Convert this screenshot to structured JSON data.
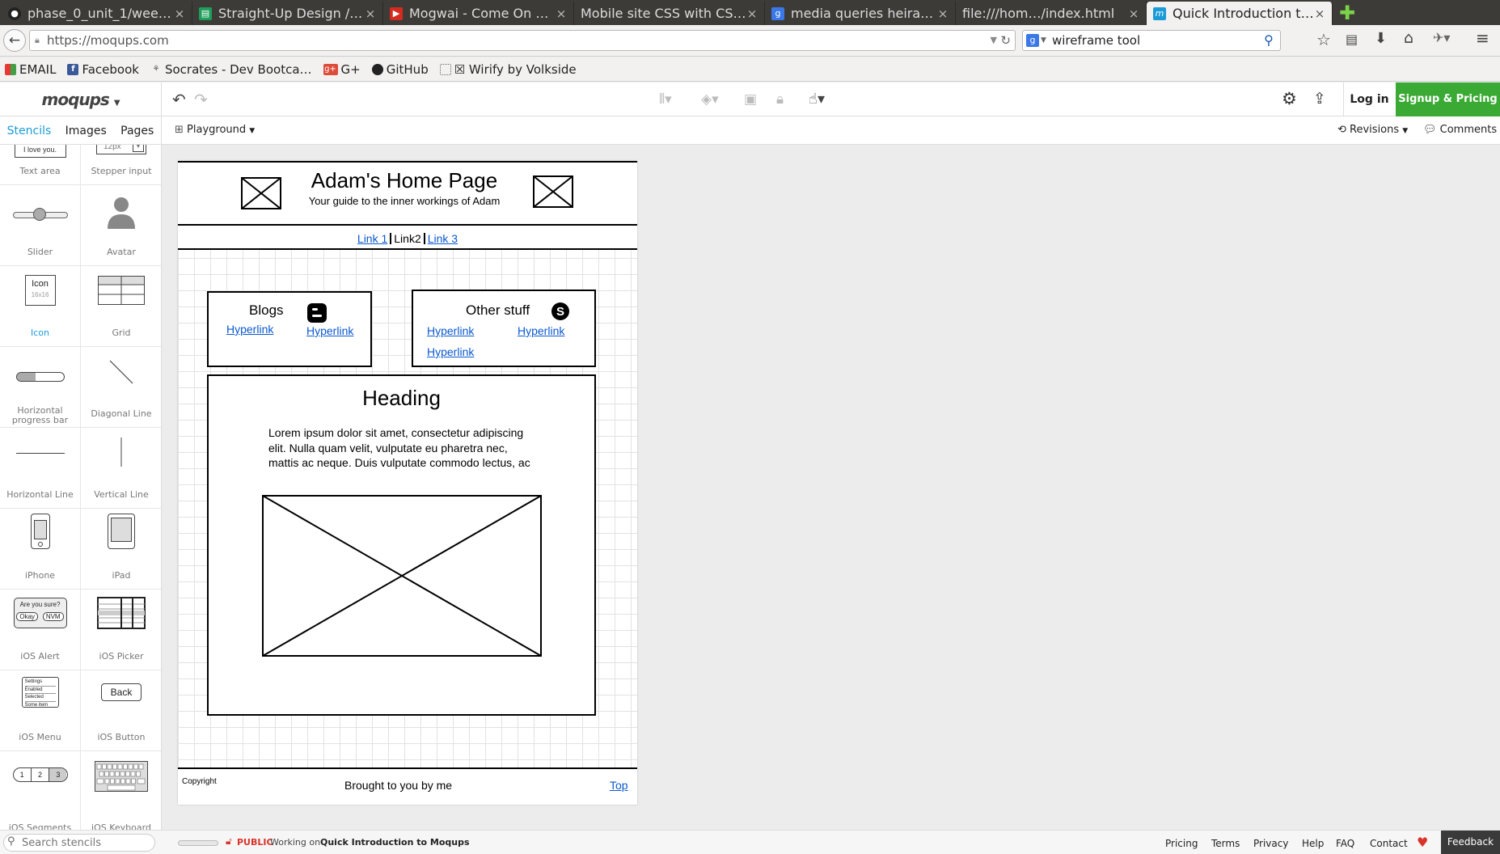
{
  "browser": {
    "tabs": [
      {
        "label": "phase_0_unit_1/wee…",
        "icon": "github-icon"
      },
      {
        "label": "Straight-Up Design /…",
        "icon": "doc-icon"
      },
      {
        "label": "Mogwai - Come On …",
        "icon": "youtube-icon"
      },
      {
        "label": "Mobile site CSS with CS…",
        "icon": "blank-icon"
      },
      {
        "label": "media queries heira…",
        "icon": "google-icon"
      },
      {
        "label": "file:///hom…/index.html",
        "icon": "blank-icon"
      },
      {
        "label": "Quick Introduction t…",
        "icon": "moqups-icon",
        "active": true
      }
    ],
    "url": "https://moqups.com",
    "search_value": "wireframe tool",
    "bookmarks": [
      {
        "label": "EMAIL",
        "icon": "google-apps-icon"
      },
      {
        "label": "Facebook",
        "icon": "facebook-icon"
      },
      {
        "label": "Socrates - Dev Bootca…",
        "icon": "socrates-icon"
      },
      {
        "label": "G+",
        "icon": "googleplus-icon"
      },
      {
        "label": "GitHub",
        "icon": "github-icon"
      },
      {
        "label": "☒ Wirify by Volkside",
        "icon": "wirify-icon"
      }
    ]
  },
  "app": {
    "logo": "moqups",
    "login": "Log in",
    "signup": "Signup & Pricing",
    "sidetabs": [
      "Stencils",
      "Images",
      "Pages"
    ],
    "project": "Playground",
    "revisions": "Revisions",
    "comments": "Comments",
    "stencils": [
      {
        "label": "Text area",
        "preview": "I love you."
      },
      {
        "label": "Stepper input",
        "preview": "12px"
      },
      {
        "label": "Slider"
      },
      {
        "label": "Avatar"
      },
      {
        "label": "Icon",
        "preview": "Icon",
        "preview_sub": "16x16",
        "selected": true
      },
      {
        "label": "Grid"
      },
      {
        "label": "Horizontal progress bar"
      },
      {
        "label": "Diagonal Line"
      },
      {
        "label": "Horizontal Line"
      },
      {
        "label": "Vertical Line"
      },
      {
        "label": "iPhone"
      },
      {
        "label": "iPad"
      },
      {
        "label": "iOS Alert",
        "preview": "Are you sure?",
        "btn1": "Okay",
        "btn2": "NVM"
      },
      {
        "label": "iOS Picker"
      },
      {
        "label": "iOS Menu",
        "items": [
          "Settings",
          "Enabled",
          "Selected",
          "Some item"
        ]
      },
      {
        "label": "iOS Button",
        "preview": "Back"
      },
      {
        "label": "iOS Segments",
        "segs": [
          "1",
          "2",
          "3"
        ]
      },
      {
        "label": "iOS Keyboard"
      }
    ],
    "search_placeholder": "Search stencils",
    "status": {
      "visibility": "PUBLIC",
      "working": "Working on",
      "doc": "Quick Introduction to Moqups"
    },
    "footer_links": [
      "Pricing",
      "Terms",
      "Privacy",
      "Help",
      "FAQ",
      "Contact"
    ],
    "feedback": "Feedback"
  },
  "wireframe": {
    "title": "Adam's Home Page",
    "subtitle": "Your guide to the inner workings of Adam",
    "nav": {
      "link1": "Link 1",
      "link2": "Link2",
      "link3": "Link 3"
    },
    "blogs": {
      "title": "Blogs",
      "link1": "Hyperlink",
      "link2": "Hyperlink"
    },
    "other": {
      "title": "Other stuff",
      "link1": "Hyperlink",
      "link2": "Hyperlink",
      "link3": "Hyperlink"
    },
    "heading": "Heading",
    "lorem": "Lorem ipsum dolor sit amet, consectetur adipiscing elit. Nulla quam velit, vulputate eu pharetra nec, mattis ac neque. Duis vulputate commodo lectus, ac blandit elit tincidunt id. Sed rhoncus, tortor sed",
    "copyright": "Copyright",
    "brought": "Brought to you by me",
    "top": "Top"
  }
}
